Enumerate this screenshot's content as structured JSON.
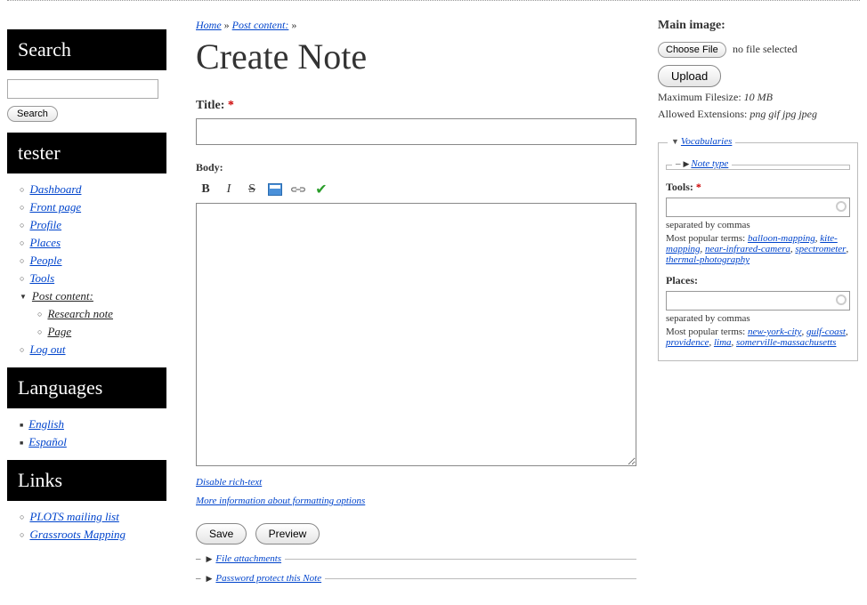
{
  "sidebar": {
    "search": {
      "title": "Search",
      "button": "Search"
    },
    "user": {
      "title": "tester",
      "items": [
        {
          "label": "Dashboard"
        },
        {
          "label": "Front page"
        },
        {
          "label": "Profile"
        },
        {
          "label": "Places"
        },
        {
          "label": "People"
        },
        {
          "label": "Tools"
        },
        {
          "label": "Post content:",
          "current": true,
          "children": [
            {
              "label": "Research note"
            },
            {
              "label": "Page"
            }
          ]
        },
        {
          "label": "Log out"
        }
      ]
    },
    "languages": {
      "title": "Languages",
      "items": [
        "English",
        "Español"
      ]
    },
    "links": {
      "title": "Links",
      "items": [
        "PLOTS mailing list",
        "Grassroots Mapping"
      ]
    }
  },
  "breadcrumb": {
    "home": "Home",
    "post_content": "Post content:"
  },
  "page_title": "Create Note",
  "title_field": {
    "label": "Title:"
  },
  "body_field": {
    "label": "Body:"
  },
  "toolbar": {
    "bold": "B",
    "italic": "I",
    "strike": "S"
  },
  "disable_rich": "Disable rich-text",
  "formatting_info": "More information about formatting options",
  "buttons": {
    "save": "Save",
    "preview": "Preview"
  },
  "collapsibles": {
    "file_attachments": "File attachments",
    "password_protect": "Password protect this Note"
  },
  "main_image": {
    "label": "Main image:",
    "choose_file": "Choose File",
    "no_file": "no file selected",
    "upload": "Upload",
    "max_label": "Maximum Filesize:",
    "max_val": "10 MB",
    "ext_label": "Allowed Extensions:",
    "ext_val": "png gif jpg jpeg"
  },
  "vocab": {
    "legend": "Vocabularies",
    "note_type": "Note type",
    "tools": {
      "label": "Tools:",
      "hint": "separated by commas",
      "popular_label": "Most popular terms:",
      "terms": [
        "balloon-mapping",
        "kite-mapping",
        "near-infrared-camera",
        "spectrometer",
        "thermal-photography"
      ]
    },
    "places": {
      "label": "Places:",
      "hint": "separated by commas",
      "popular_label": "Most popular terms:",
      "terms": [
        "new-york-city",
        "gulf-coast",
        "providence",
        "lima",
        "somerville-massachusetts"
      ]
    }
  }
}
